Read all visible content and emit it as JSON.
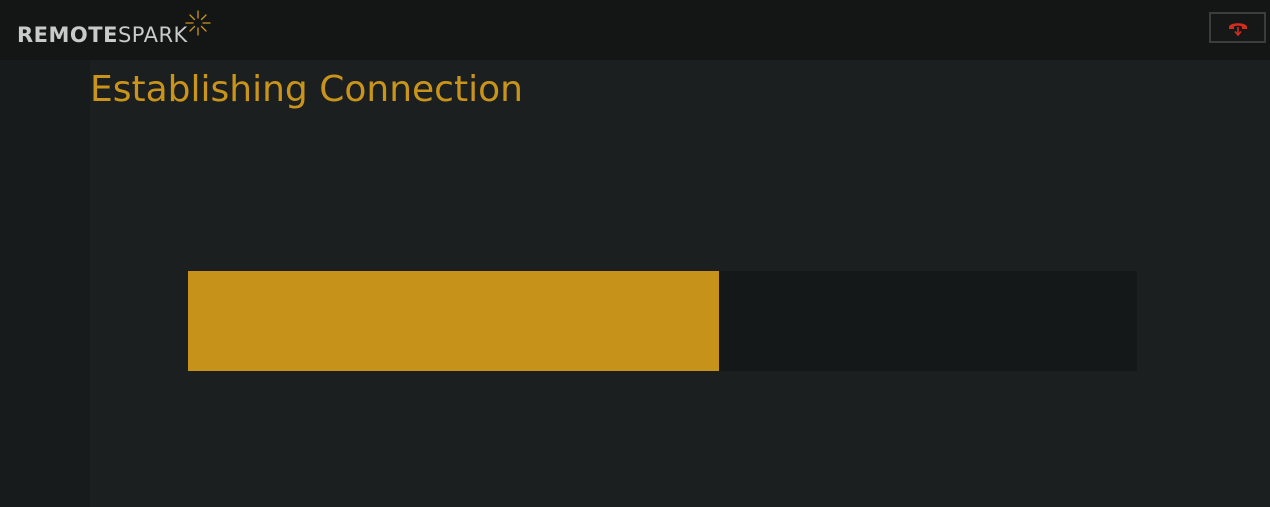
{
  "brand": {
    "name_bold": "REMOTE",
    "name_light": "SPARK",
    "icon": "spark-icon"
  },
  "toolbar": {
    "disconnect_icon": "phone-hangup-icon"
  },
  "main": {
    "title": "Establishing Connection"
  },
  "progress": {
    "value_fraction": 0.56
  },
  "colors": {
    "accent": "#c6921a",
    "disconnect_icon": "#d42b1e",
    "background": "#1c1f20",
    "topbar": "#141616"
  }
}
